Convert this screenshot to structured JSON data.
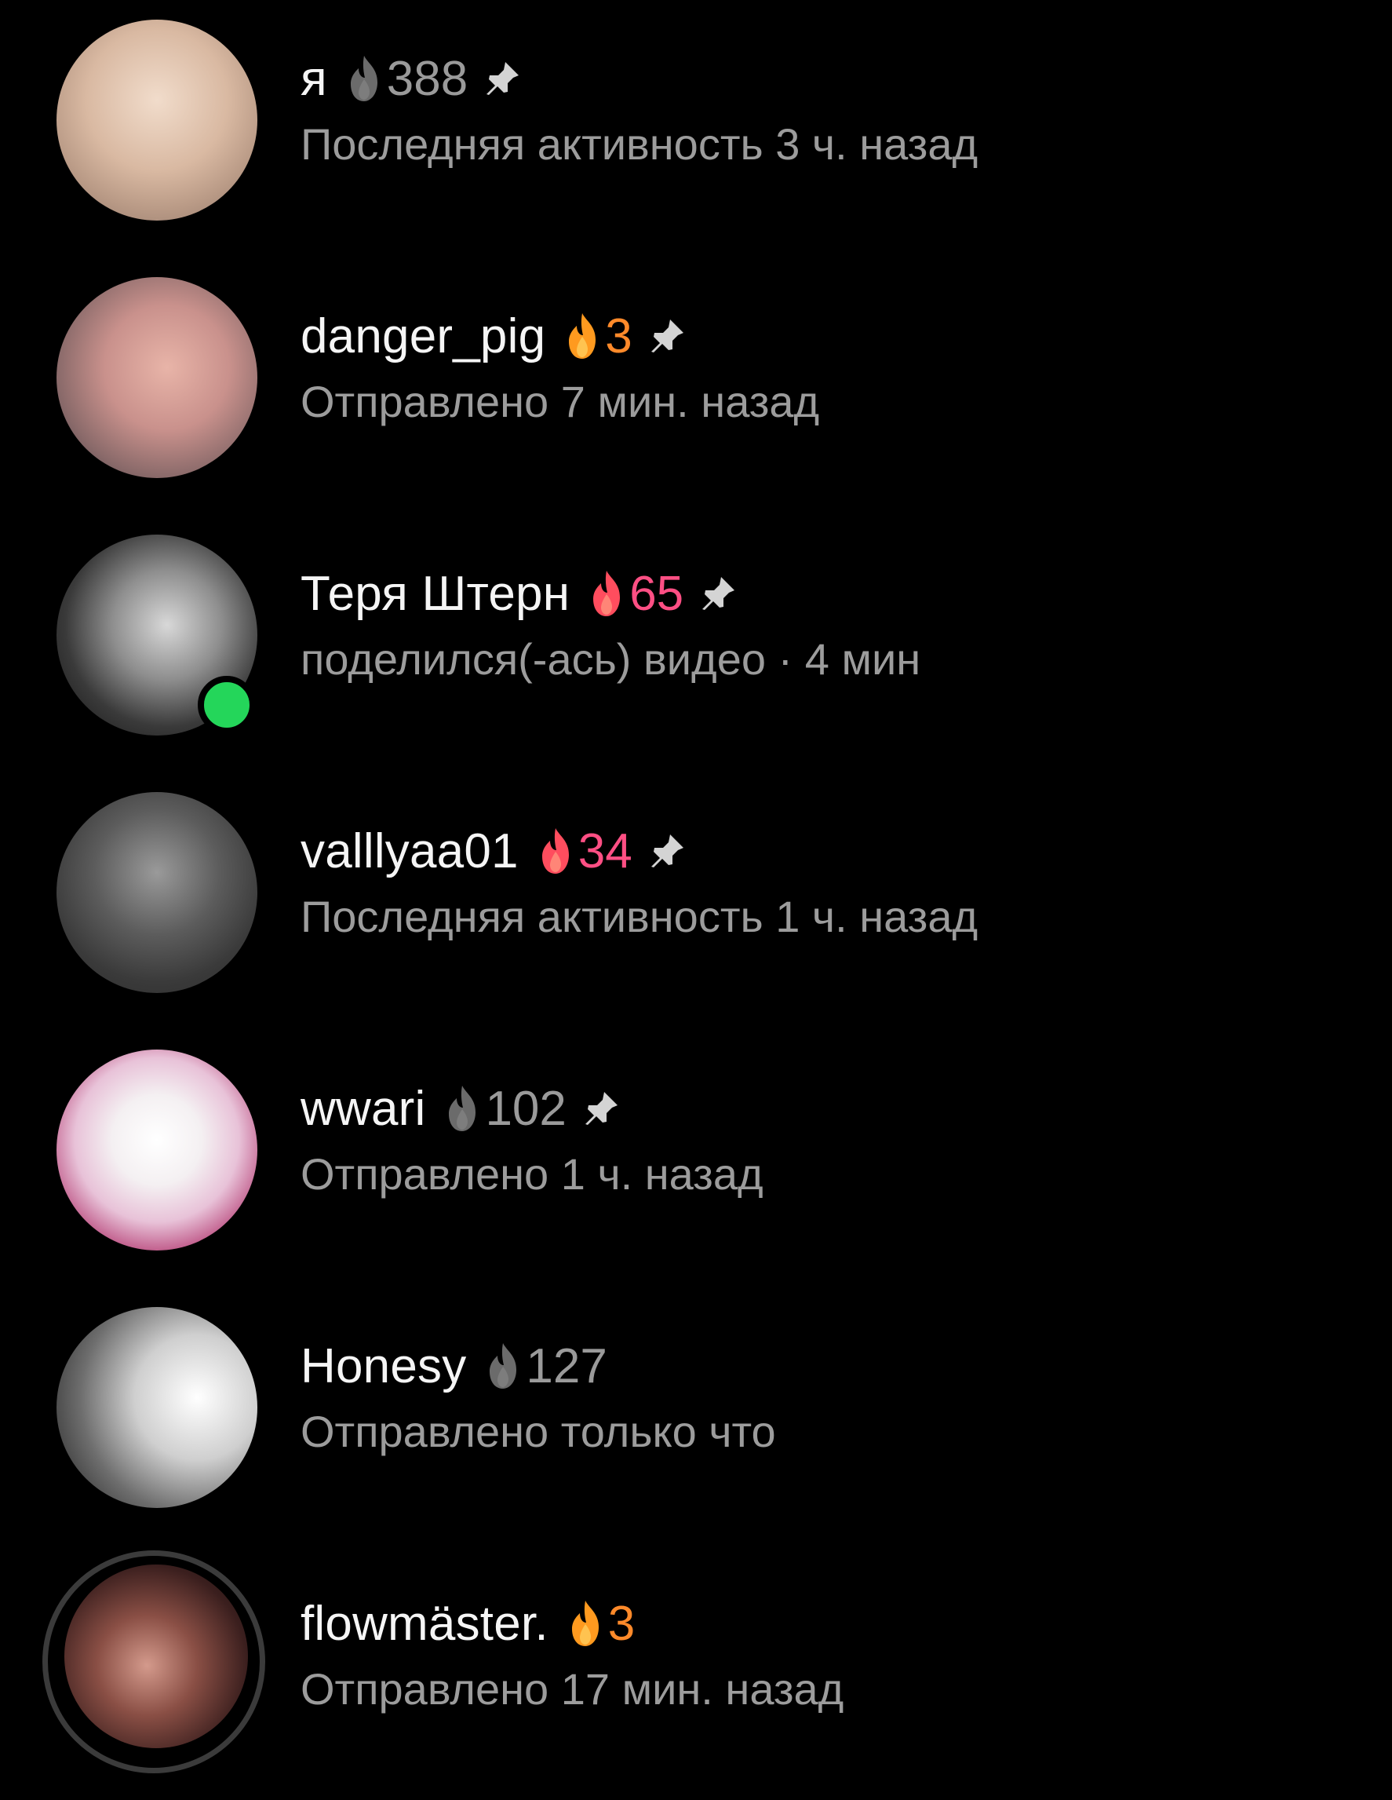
{
  "chats": [
    {
      "name": "я",
      "streak": "388",
      "flame_color": "#6b6b6b",
      "count_color": "#9a9a9a",
      "status": "Последняя активность 3 ч. назад",
      "pinned": true
    },
    {
      "name": "danger_pig",
      "streak": "3",
      "flame_color": "#ff9a1f",
      "count_color": "#ff8a2a",
      "status": "Отправлено 7 мин. назад",
      "pinned": true
    },
    {
      "name": "Теря Штерн",
      "streak": "65",
      "flame_color": "#ff4d5e",
      "count_color": "#ff4f84",
      "status": "поделился(-ась) видео · 4 мин",
      "pinned": true,
      "online": true
    },
    {
      "name": "valllyaa01",
      "streak": "34",
      "flame_color": "#ff4d5e",
      "count_color": "#ff4f84",
      "status": "Последняя активность 1 ч. назад",
      "pinned": true
    },
    {
      "name": "wwari",
      "streak": "102",
      "flame_color": "#6b6b6b",
      "count_color": "#9a9a9a",
      "status": "Отправлено 1 ч. назад",
      "pinned": true
    },
    {
      "name": "Honesy",
      "streak": "127",
      "flame_color": "#6b6b6b",
      "count_color": "#9a9a9a",
      "status": "Отправлено только что",
      "pinned": false
    },
    {
      "name": "flowmäster.",
      "streak": "3",
      "flame_color": "#ff9a1f",
      "count_color": "#ff8a2a",
      "status": "Отправлено 17 мин. назад",
      "pinned": false,
      "story_ring": true
    }
  ],
  "icons": {
    "flame": "flame-icon",
    "pin": "pin-icon",
    "online": "online-indicator"
  }
}
